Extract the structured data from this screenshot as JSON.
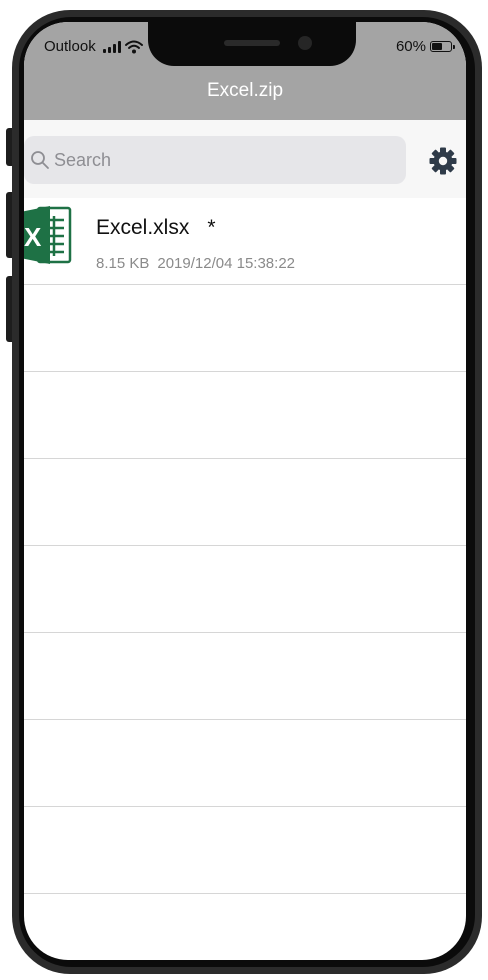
{
  "status_bar": {
    "carrier": "Outlook",
    "battery_percent": "60%",
    "battery_level": 0.6
  },
  "nav": {
    "title": "Excel.zip"
  },
  "search": {
    "placeholder": "Search",
    "value": ""
  },
  "files": [
    {
      "name": "Excel.xlsx",
      "marker": "*",
      "size": "8.15 KB",
      "date": "2019/12/04 15:38:22",
      "icon": "excel-file-icon"
    }
  ],
  "icons": {
    "search": "search-icon",
    "settings": "gear-icon",
    "signal": "signal-icon",
    "wifi": "wifi-icon",
    "battery": "battery-icon"
  },
  "colors": {
    "nav_bar": "#a4a4a4",
    "excel_green": "#1e7145",
    "gear": "#2f3b49"
  }
}
